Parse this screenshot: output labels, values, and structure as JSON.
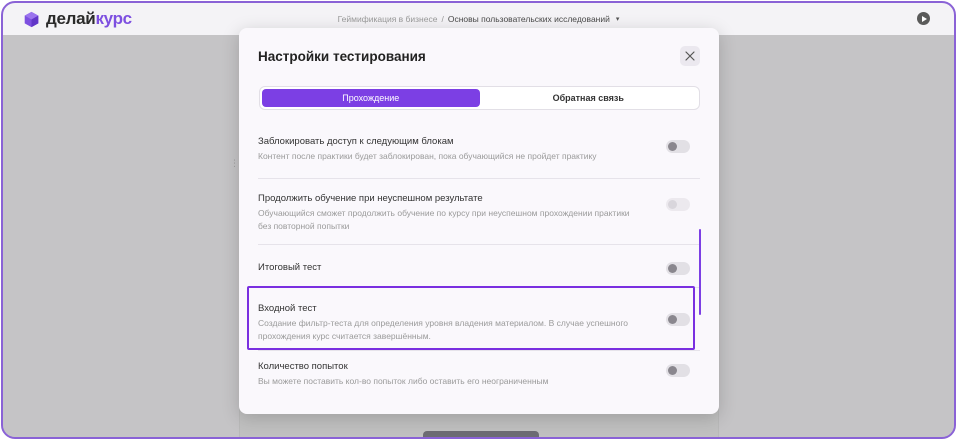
{
  "app": {
    "logo_part1": "делай",
    "logo_part2": "курс",
    "logo_icon": "cube-logo-icon",
    "brand_color": "#7d4fe0"
  },
  "breadcrumb": {
    "parent": "Геймификация в бизнесе",
    "separator": "/",
    "current": "Основы пользовательских исследований"
  },
  "modal": {
    "title": "Настройки тестирования",
    "tabs": [
      {
        "label": "Прохождение",
        "active": true
      },
      {
        "label": "Обратная связь",
        "active": false
      }
    ],
    "settings": [
      {
        "title": "Заблокировать доступ к следующим блокам",
        "description": "Контент после практики будет заблокирован, пока обучающийся не пройдет практику",
        "enabled": false
      },
      {
        "title": "Продолжить обучение при неуспешном результате",
        "description": "Обучающийся сможет продолжить обучение по курсу при неуспешном прохождении практики без повторной попытки",
        "enabled": false,
        "disabled": true
      },
      {
        "title": "Итоговый тест",
        "description": "",
        "enabled": false
      },
      {
        "title": "Входной тест",
        "description": "Создание фильтр-теста для определения уровня владения материалом. В случае успешного прохождения курс считается завершённым.",
        "enabled": false,
        "highlighted": true
      },
      {
        "title": "Количество попыток",
        "description": "Вы можете поставить кол-во попыток либо оставить его неограниченным",
        "enabled": false
      }
    ]
  },
  "colors": {
    "accent": "#7c3fe4",
    "highlight_border": "#7a2fe0",
    "frame_border": "#8a62d6"
  }
}
